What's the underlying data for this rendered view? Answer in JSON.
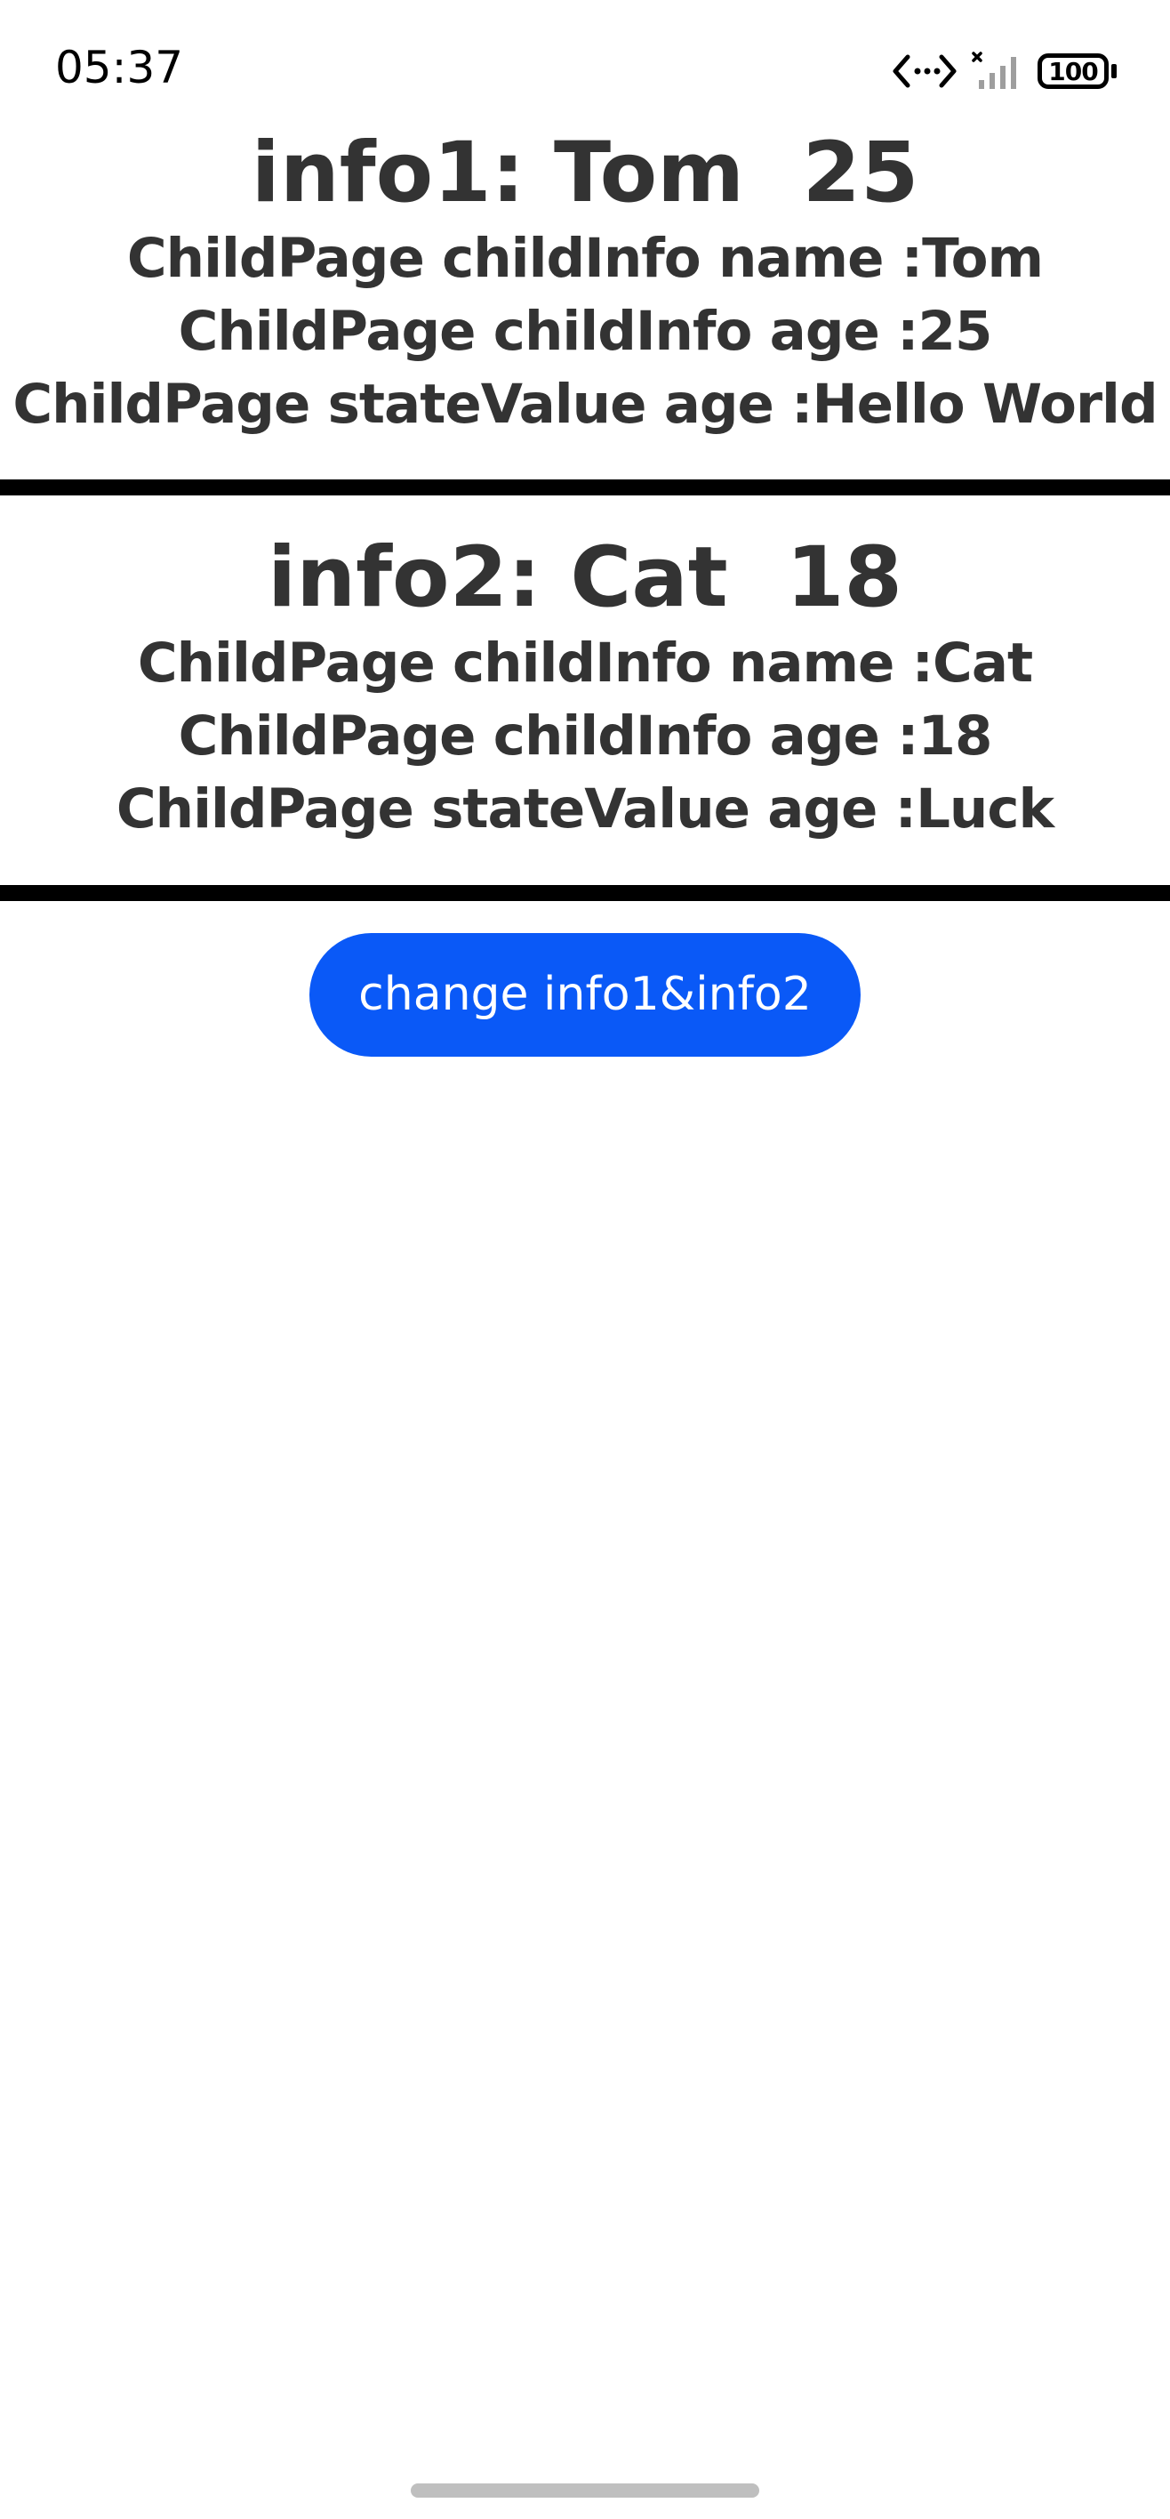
{
  "status_bar": {
    "time": "05:37",
    "battery": "100",
    "icons": [
      "data-transfer-icon",
      "signal-icon",
      "battery-icon"
    ]
  },
  "info1": {
    "title": "info1: Tom  25",
    "lines": [
      "ChildPage childInfo name :Tom",
      "ChildPage childInfo age :25",
      "ChildPage stateValue age :Hello World"
    ]
  },
  "info2": {
    "title": "info2: Cat  18",
    "lines": [
      "ChildPage childInfo name :Cat",
      "ChildPage childInfo age :18",
      "ChildPage stateValue age :Luck"
    ]
  },
  "button": {
    "label": "change info1&info2"
  },
  "colors": {
    "button_bg": "#0a59f7",
    "text": "#333333",
    "divider": "#000000"
  }
}
